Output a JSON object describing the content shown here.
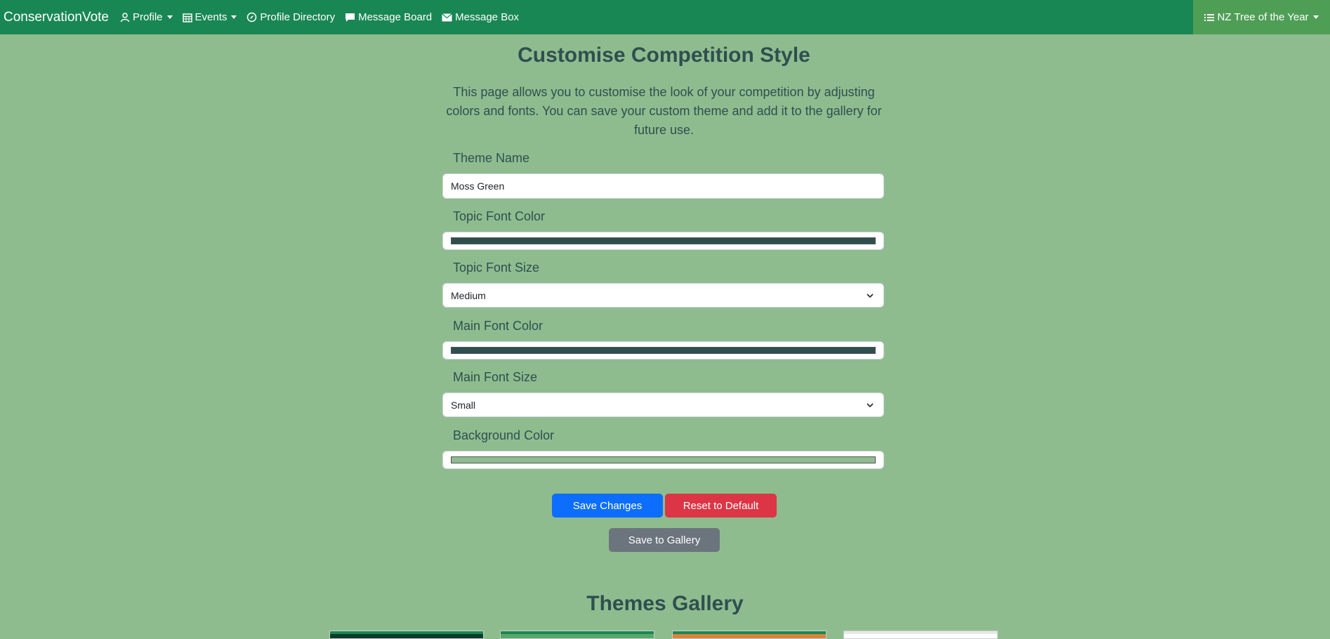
{
  "nav": {
    "brand": "ConservationVote",
    "items": [
      {
        "label": "Profile",
        "icon": "user-icon",
        "dropdown": true
      },
      {
        "label": "Events",
        "icon": "calendar-icon",
        "dropdown": true
      },
      {
        "label": "Profile Directory",
        "icon": "compass-icon",
        "dropdown": false
      },
      {
        "label": "Message Board",
        "icon": "chat-icon",
        "dropdown": false
      },
      {
        "label": "Message Box",
        "icon": "envelope-icon",
        "dropdown": false
      }
    ],
    "competition": "NZ Tree of the Year"
  },
  "page": {
    "title": "Customise Competition Style",
    "intro": "This page allows you to customise the look of your competition by adjusting colors and fonts. You can save your custom theme and add it to the gallery for future use."
  },
  "form": {
    "theme_name_label": "Theme Name",
    "theme_name_value": "Moss Green",
    "topic_color_label": "Topic Font Color",
    "topic_color_value": "#2f4f4f",
    "topic_size_label": "Topic Font Size",
    "topic_size_value": "Medium",
    "main_color_label": "Main Font Color",
    "main_color_value": "#2f4f4f",
    "main_size_label": "Main Font Size",
    "main_size_value": "Small",
    "background_color_label": "Background Color",
    "background_color_value": "#8fbc8f"
  },
  "buttons": {
    "save": "Save Changes",
    "reset": "Reset to Default",
    "gallery": "Save to Gallery"
  },
  "gallery": {
    "title": "Themes Gallery"
  },
  "colors": {
    "navbar": "#198754",
    "save_button": "#0d6efd",
    "reset_button": "#dc3545",
    "gallery_button": "#6c757d"
  }
}
